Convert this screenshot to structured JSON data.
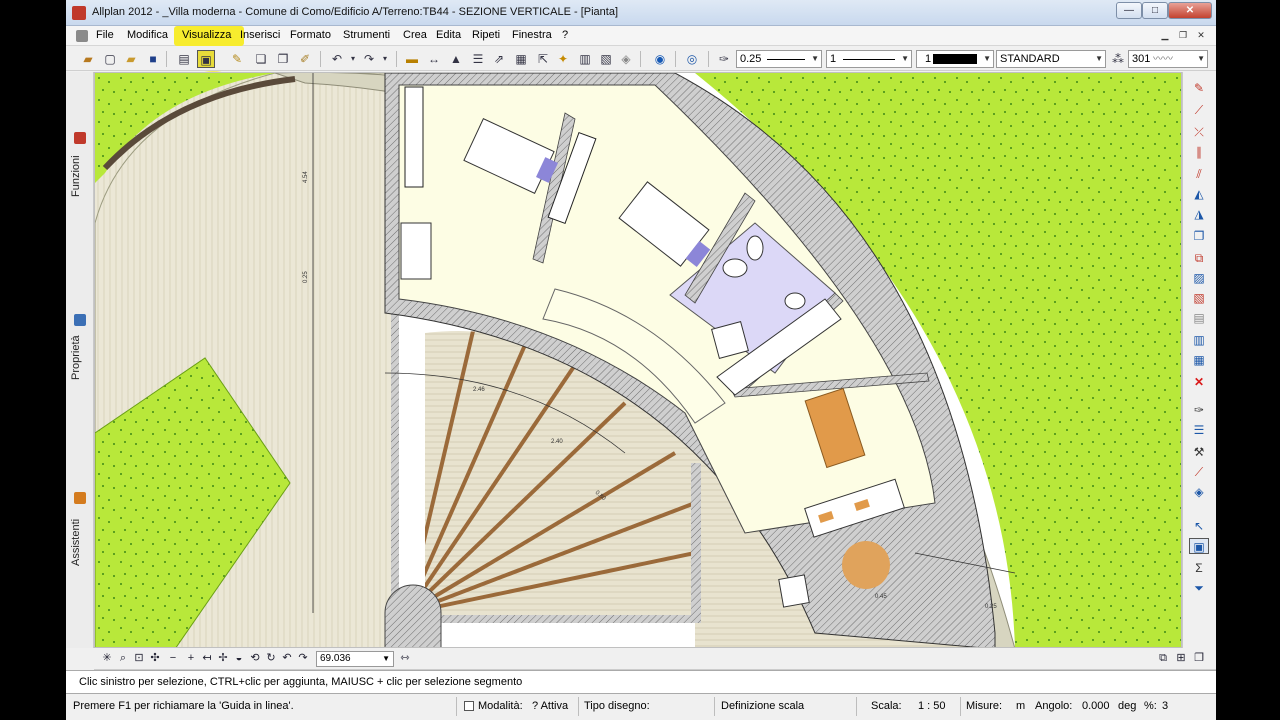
{
  "window": {
    "title": "Allplan 2012 - _Villa moderna - Comune di Como/Edificio A/Terreno:TB44 - SEZIONE VERTICALE - [Pianta]",
    "minimize": "—",
    "maximize": "□",
    "close": "✕"
  },
  "menu": {
    "items": [
      "File",
      "Modifica",
      "Visualizza",
      "Inserisci",
      "Formato",
      "Strumenti",
      "Crea",
      "Edita",
      "Ripeti",
      "Finestra",
      "?"
    ],
    "active": "Visualizza"
  },
  "toolbar": {
    "pen_thickness": "0.25",
    "line_type": "1",
    "color_index": "1",
    "layer": "STANDARD",
    "hatch_pattern": "301"
  },
  "side_tabs": [
    "Funzioni",
    "Proprietà",
    "Assistenti"
  ],
  "canvas_toolbar": {
    "zoom_value": "69.036"
  },
  "prompt": {
    "text": "Clic sinistro per selezione, CTRL+clic per aggiunta, MAIUSC + clic per selezione segmento"
  },
  "status_bar": {
    "help": "Premere F1 per richiamare la 'Guida in linea'.",
    "mode_label": "Modalità:",
    "mode_value": "? Attiva",
    "drawing_type_label": "Tipo disegno:",
    "drawing_type_value": "",
    "scale_definition": "Definizione scala",
    "scale_label": "Scala:",
    "scale_value": "1 : 50",
    "units_label": "Misure:",
    "units_value": "m",
    "angle_label": "Angolo:",
    "angle_value": "0.000",
    "angle_unit": "deg",
    "percent_label": "%:",
    "percent_value": "3"
  },
  "colors": {
    "lawn": "#b8e83a",
    "floor_light": "#fdfde4",
    "bath_floor": "#dcd8f7",
    "wall_hatch": "#9e9e9e",
    "beam": "#9b6a3a",
    "table": "#e19a4a",
    "highlight": "#f7ec2e",
    "plaza": "#d7d5c0"
  },
  "drawing_labels": {
    "dims": [
      "4.54",
      "2.46",
      "0.25",
      "2.40",
      "0.80",
      "0.25",
      "0.45"
    ]
  }
}
